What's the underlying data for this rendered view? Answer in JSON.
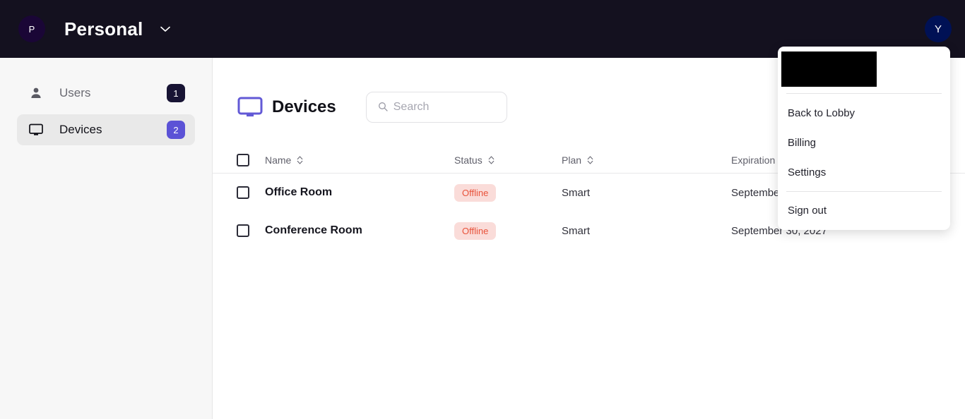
{
  "topbar": {
    "org_initial": "P",
    "org_name": "Personal",
    "chevron_icon": "chevron-down-icon",
    "user_initial": "Y"
  },
  "sidebar": {
    "items": [
      {
        "label": "Users",
        "icon": "person-icon",
        "badge": "1",
        "badge_color": "#181434",
        "selected": false
      },
      {
        "label": "Devices",
        "icon": "monitor-icon",
        "badge": "2",
        "badge_color": "#5b52d6",
        "selected": true
      }
    ]
  },
  "main": {
    "page_icon": "monitor-icon",
    "page_title": "Devices",
    "search": {
      "icon": "search-icon",
      "value": "",
      "placeholder": "Search"
    },
    "table": {
      "columns": [
        {
          "key": "name",
          "label": "Name",
          "sortable": true
        },
        {
          "key": "status",
          "label": "Status",
          "sortable": true
        },
        {
          "key": "plan",
          "label": "Plan",
          "sortable": true
        },
        {
          "key": "exp",
          "label": "Expiration",
          "sortable": true
        }
      ],
      "rows": [
        {
          "name": "Office Room",
          "status": "Offline",
          "plan": "Smart",
          "expiration": "September 30, 2027",
          "checked": false
        },
        {
          "name": "Conference Room",
          "status": "Offline",
          "plan": "Smart",
          "expiration": "September 30, 2027",
          "checked": false
        }
      ],
      "header_checked": false,
      "status_colors": {
        "offline_bg": "#fadcd9",
        "offline_text": "#e8533b"
      }
    }
  },
  "account_menu": {
    "redacted": true,
    "items": [
      {
        "label": "Back to Lobby"
      },
      {
        "label": "Billing"
      },
      {
        "label": "Settings"
      },
      {
        "label": "Sign out"
      }
    ]
  },
  "colors": {
    "topbar_bg": "#14111f",
    "sidebar_bg": "#f7f7f7",
    "accent_purple": "#5b52d6",
    "navy_badge": "#181434"
  }
}
